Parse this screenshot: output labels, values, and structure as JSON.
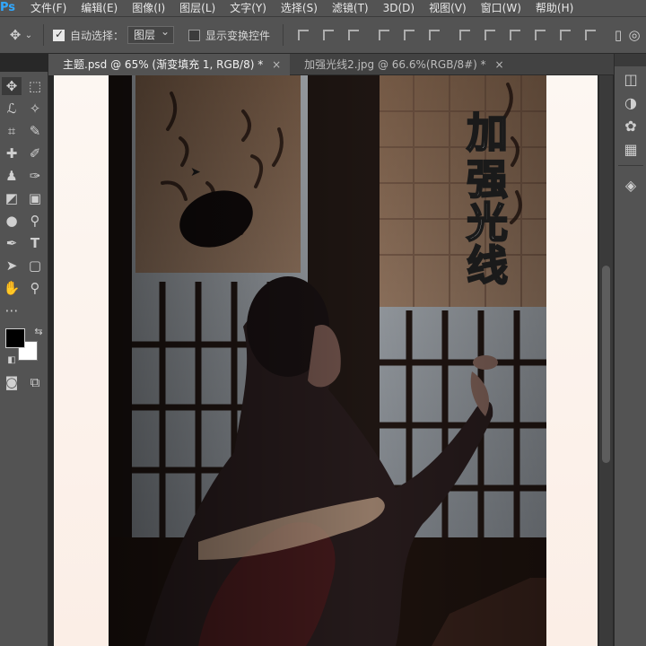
{
  "app": {
    "logo": "Ps"
  },
  "menu": [
    "文件(F)",
    "编辑(E)",
    "图像(I)",
    "图层(L)",
    "文字(Y)",
    "选择(S)",
    "滤镜(T)",
    "3D(D)",
    "视图(V)",
    "窗口(W)",
    "帮助(H)"
  ],
  "options": {
    "auto_select_label": "自动选择：",
    "auto_select_checked": true,
    "auto_select_target": "图层",
    "show_transform_label": "显示变换控件",
    "show_transform_checked": false
  },
  "tabs": [
    {
      "label": "主题.psd @ 65% (渐变填充 1, RGB/8) *",
      "active": true
    },
    {
      "label": "加强光线2.jpg @ 66.6%(RGB/8#) *",
      "active": false
    }
  ],
  "canvas": {
    "overlay_text": "加强光线"
  },
  "toolbar": {
    "tools": [
      "move-tool",
      "marquee-tool",
      "lasso-tool",
      "magic-wand-tool",
      "crop-tool",
      "eyedropper-tool",
      "healing-brush-tool",
      "brush-tool",
      "clone-stamp-tool",
      "history-brush-tool",
      "eraser-tool",
      "gradient-tool",
      "blur-tool",
      "dodge-tool",
      "pen-tool",
      "type-tool",
      "path-selection-tool",
      "shape-tool",
      "hand-tool",
      "zoom-tool",
      "more-tools"
    ],
    "foreground_color": "#000000",
    "background_color": "#ffffff"
  },
  "colors": {
    "accent": "#31a8ff",
    "chrome": "#535353",
    "workspace": "#282828"
  }
}
